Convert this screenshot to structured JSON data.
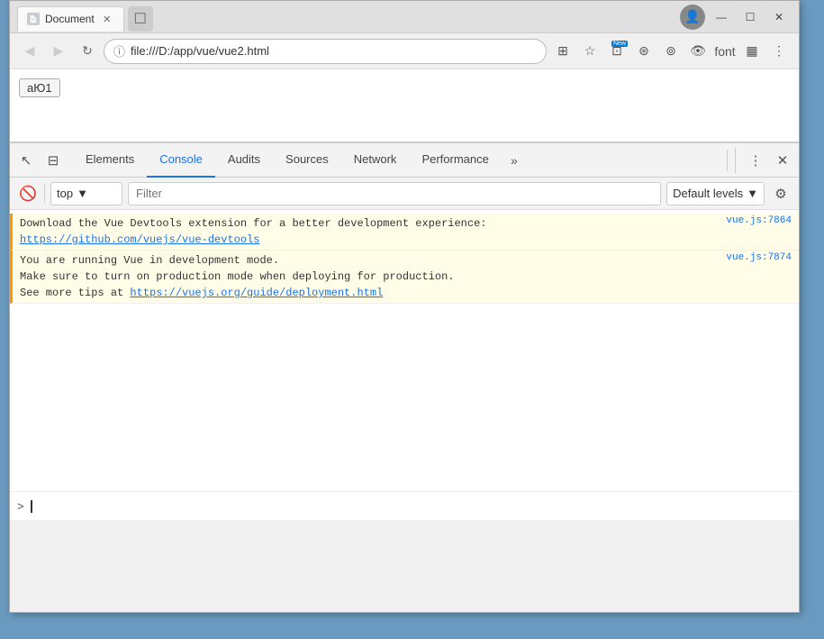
{
  "window": {
    "title": "Document",
    "url": "file:///D:/app/vue/vue2.html"
  },
  "titlebar": {
    "tab_label": "Document",
    "new_tab_icon": "+",
    "profile_icon": "👤",
    "minimize": "—",
    "maximize": "☐",
    "close": "✕"
  },
  "navbar": {
    "back_label": "◀",
    "forward_label": "▶",
    "reload_label": "↻",
    "address": "file:///D:/app/vue/vue2.html",
    "lock_icon": "ⓘ",
    "translate_icon": "⊞",
    "star_icon": "☆",
    "extensions_icon": "⊡",
    "shield_icon": "⊛",
    "shield2_icon": "⊚",
    "eye_icon": "👁",
    "font_label": "font",
    "reader_label": "▦",
    "menu_icon": "⋮"
  },
  "page": {
    "button_label": "aЮ1"
  },
  "devtools": {
    "tabs": [
      {
        "id": "elements",
        "label": "Elements",
        "active": false
      },
      {
        "id": "console",
        "label": "Console",
        "active": true
      },
      {
        "id": "audits",
        "label": "Audits",
        "active": false
      },
      {
        "id": "sources",
        "label": "Sources",
        "active": false
      },
      {
        "id": "network",
        "label": "Network",
        "active": false
      },
      {
        "id": "performance",
        "label": "Performance",
        "active": false
      }
    ],
    "more_icon": "»",
    "menu_icon": "⋮",
    "close_icon": "✕",
    "cursor_icon": "↖",
    "mobile_icon": "⊟"
  },
  "console": {
    "clear_icon": "🚫",
    "context_label": "top",
    "context_arrow": "▼",
    "filter_placeholder": "Filter",
    "levels_label": "Default levels",
    "levels_arrow": "▼",
    "settings_icon": "⚙",
    "messages": [
      {
        "id": "msg1",
        "type": "warning",
        "text_parts": [
          {
            "type": "text",
            "content": "Download the Vue Devtools extension for a better development experience:"
          },
          {
            "type": "link",
            "content": "https://github.com/vuejs/vue-devtools"
          }
        ],
        "source": "vue.js:7864"
      },
      {
        "id": "msg2",
        "type": "warning",
        "text_parts": [
          {
            "type": "text",
            "content": "You are running Vue in development mode.\nMake sure to turn on production mode when deploying for production.\nSee more tips at "
          },
          {
            "type": "link",
            "content": "https://vuejs.org/guide/deployment.html"
          }
        ],
        "source": "vue.js:7874"
      }
    ],
    "input_chevron": ">",
    "input_text": ""
  }
}
